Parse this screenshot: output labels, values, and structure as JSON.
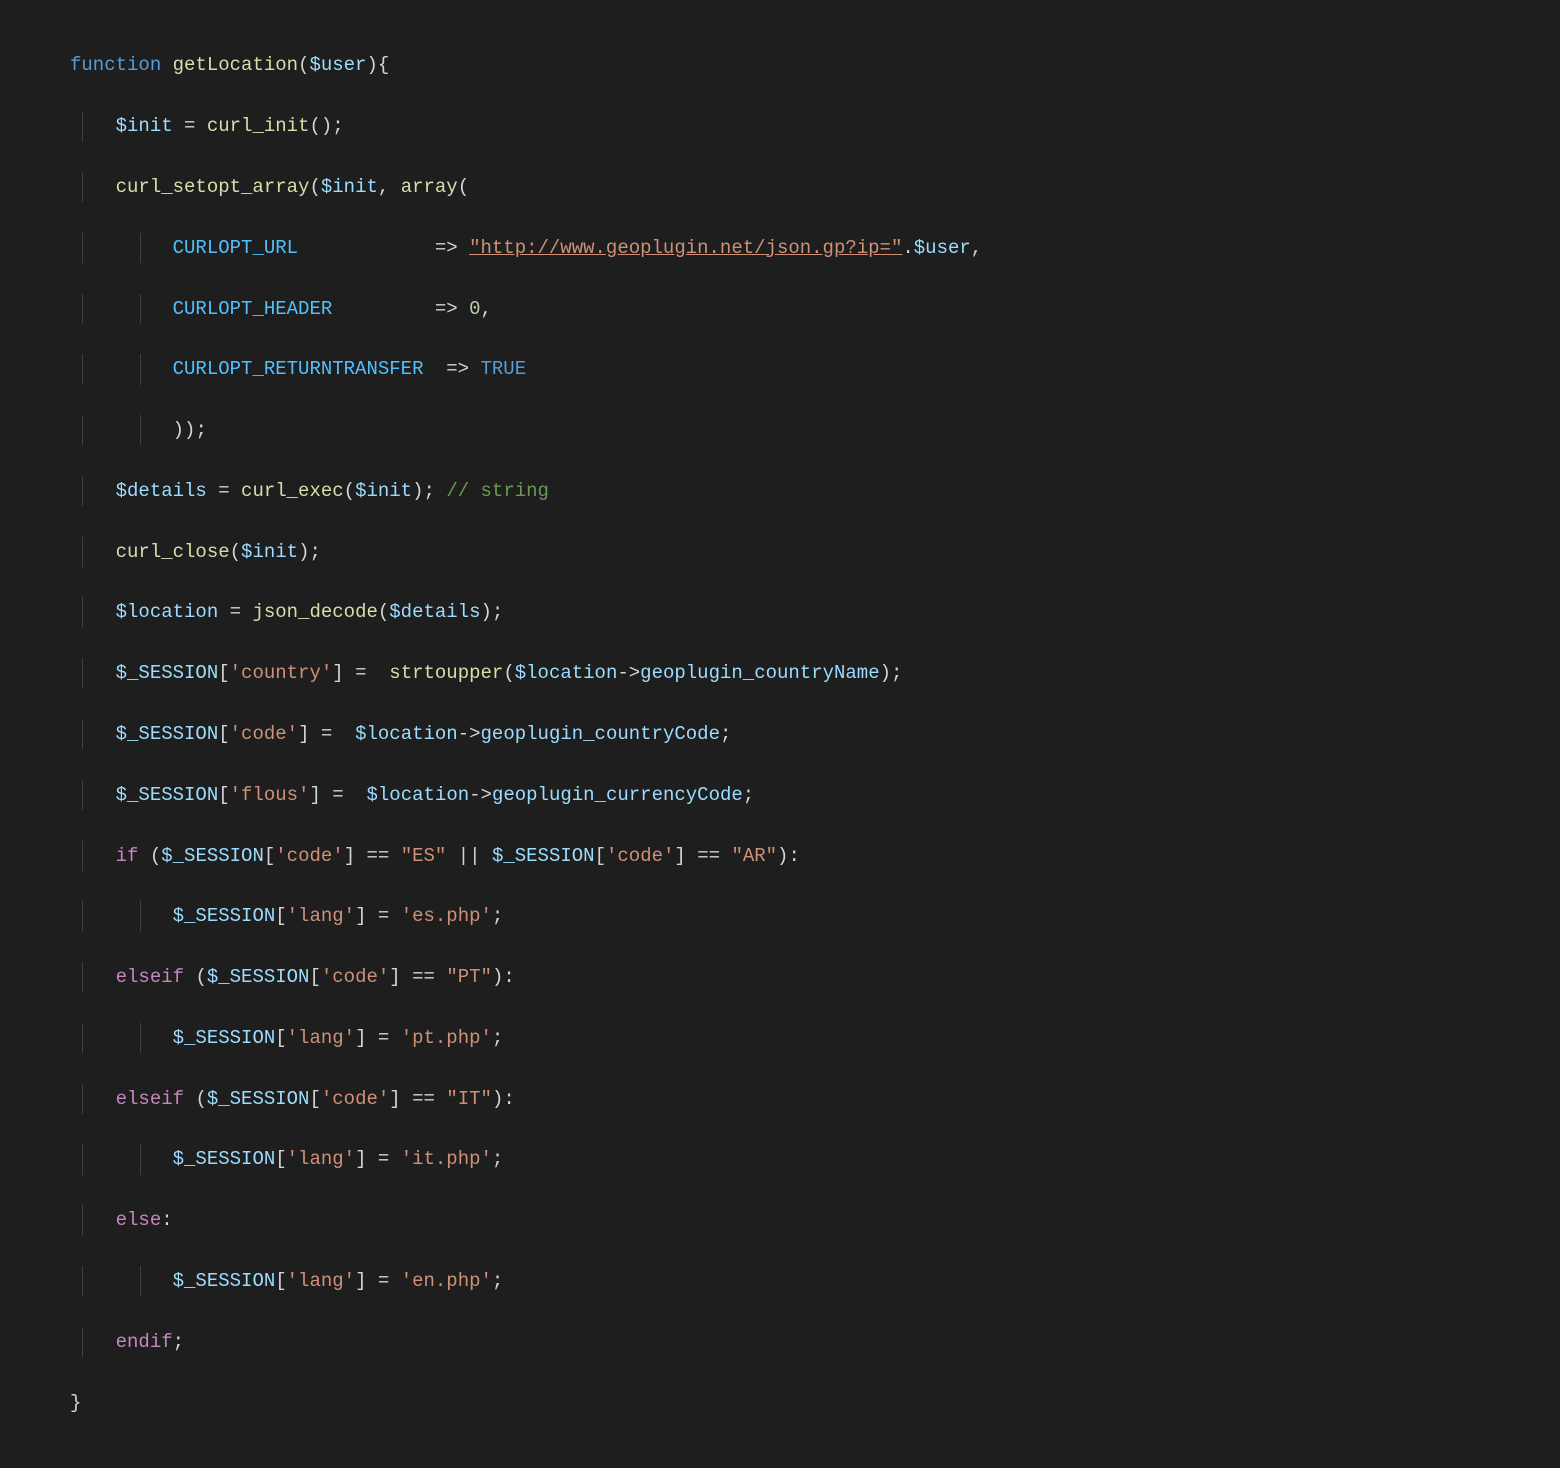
{
  "code": {
    "kw_function": "function",
    "fn_name": "getLocation",
    "param": "$user",
    "var_init": "$init",
    "fn_curl_init": "curl_init",
    "fn_curl_setopt_array": "curl_setopt_array",
    "fn_array": "array",
    "const_url": "CURLOPT_URL",
    "str_url": "\"http://www.geoplugin.net/json.gp?ip=\"",
    "var_user": "$user",
    "const_header": "CURLOPT_HEADER",
    "num_zero": "0",
    "const_return": "CURLOPT_RETURNTRANSFER",
    "bool_true": "TRUE",
    "var_details": "$details",
    "fn_curl_exec": "curl_exec",
    "comment_string": "// string",
    "fn_curl_close": "curl_close",
    "var_location": "$location",
    "fn_json_decode": "json_decode",
    "var_session": "$_SESSION",
    "key_country": "'country'",
    "fn_strtoupper": "strtoupper",
    "prop_countryName": "geoplugin_countryName",
    "key_code": "'code'",
    "prop_countryCode": "geoplugin_countryCode",
    "key_flous": "'flous'",
    "prop_currencyCode": "geoplugin_currencyCode",
    "kw_if": "if",
    "str_ES": "\"ES\"",
    "str_AR": "\"AR\"",
    "key_lang": "'lang'",
    "str_es_php": "'es.php'",
    "kw_elseif": "elseif",
    "str_PT": "\"PT\"",
    "str_pt_php": "'pt.php'",
    "str_IT": "\"IT\"",
    "str_it_php": "'it.php'",
    "kw_else": "else",
    "str_en_php": "'en.php'",
    "kw_endif": "endif"
  }
}
